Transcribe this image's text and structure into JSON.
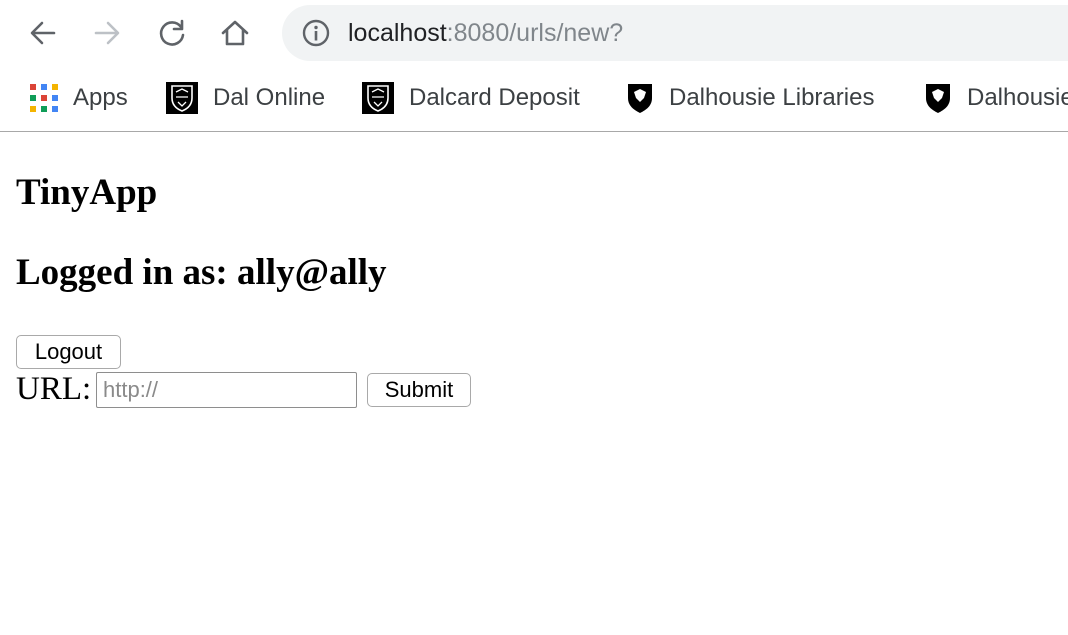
{
  "browser": {
    "url_host": "localhost",
    "url_rest": ":8080/urls/new?"
  },
  "bookmarks": {
    "apps": "Apps",
    "dal_online": "Dal Online",
    "dalcard_deposit": "Dalcard Deposit",
    "dalhousie_libraries": "Dalhousie Libraries",
    "dalhousie": "Dalhousie"
  },
  "page": {
    "title": "TinyApp",
    "logged_in": "Logged in as: ally@ally",
    "logout_label": "Logout",
    "url_label": "URL:",
    "url_placeholder": "http://",
    "url_value": "",
    "submit_label": "Submit"
  },
  "colors": {
    "omnibox_bg": "#f1f3f4",
    "icon_gray": "#5f6368",
    "icon_disabled": "#bdc1c6"
  }
}
